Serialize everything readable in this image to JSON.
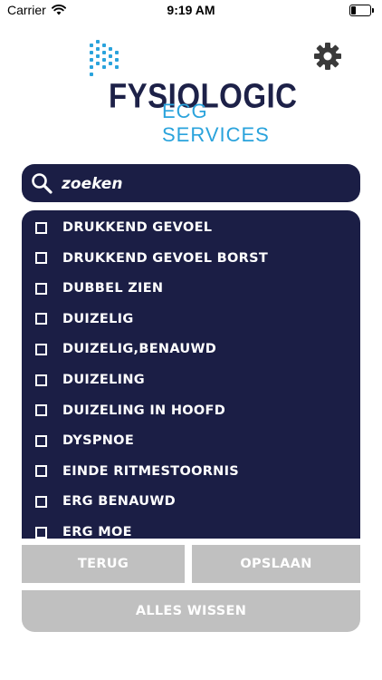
{
  "status_bar": {
    "carrier": "Carrier",
    "time": "9:19 AM",
    "battery_level": 0.25
  },
  "logo": {
    "title": "FYSIOLOGIC",
    "subtitle": "ECG SERVICES",
    "title_color": "#1d2148",
    "subtitle_color": "#2aa3dc"
  },
  "settings": {
    "icon": "gear-icon"
  },
  "search": {
    "placeholder": "zoeken",
    "value": "",
    "icon": "search-icon"
  },
  "list": {
    "items": [
      {
        "label": "DRUKKEND GEVOEL",
        "checked": false
      },
      {
        "label": "DRUKKEND GEVOEL BORST",
        "checked": false
      },
      {
        "label": "DUBBEL ZIEN",
        "checked": false
      },
      {
        "label": "DUIZELIG",
        "checked": false
      },
      {
        "label": "DUIZELIG,BENAUWD",
        "checked": false
      },
      {
        "label": "DUIZELING",
        "checked": false
      },
      {
        "label": "DUIZELING IN HOOFD",
        "checked": false
      },
      {
        "label": "DYSPNOE",
        "checked": false
      },
      {
        "label": "EINDE RITMESTOORNIS",
        "checked": false
      },
      {
        "label": "ERG BENAUWD",
        "checked": false
      },
      {
        "label": "ERG MOE",
        "checked": false
      }
    ]
  },
  "buttons": {
    "back_label": "TERUG",
    "save_label": "OPSLAAN",
    "clear_label": "ALLES WISSEN"
  },
  "colors": {
    "panel": "#1b1e45",
    "button": "#c0c0c0",
    "text_light": "#ffffff"
  }
}
